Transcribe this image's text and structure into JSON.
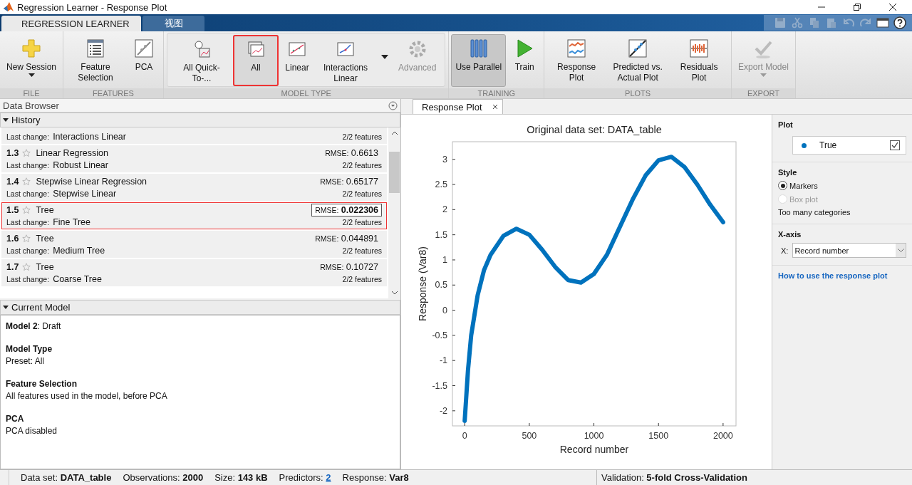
{
  "window": {
    "title": "Regression Learner - Response Plot"
  },
  "ribbon_tabs": [
    {
      "label": "REGRESSION LEARNER",
      "selected": true
    },
    {
      "label": "视图",
      "selected": false
    }
  ],
  "quick_access": [
    {
      "kind": "save",
      "disabled": true
    },
    {
      "kind": "cut",
      "disabled": true
    },
    {
      "kind": "copy",
      "disabled": true
    },
    {
      "kind": "paste",
      "disabled": true
    },
    {
      "kind": "undo",
      "disabled": true
    },
    {
      "kind": "redo",
      "disabled": true
    },
    {
      "kind": "window",
      "disabled": false
    },
    {
      "kind": "help",
      "disabled": false
    }
  ],
  "ribbon_groups": [
    {
      "label": "FILE",
      "buttons": [
        {
          "label": "New Session",
          "selected": false,
          "disabled": false,
          "caret": true
        }
      ]
    },
    {
      "label": "FEATURES",
      "buttons": [
        {
          "label": "Feature Selection",
          "selected": false,
          "disabled": false,
          "caret": false
        },
        {
          "label": "PCA",
          "selected": false,
          "disabled": false,
          "caret": false
        }
      ]
    },
    {
      "label": "MODEL TYPE",
      "buttons": [
        {
          "label": "All Quick-To-...",
          "selected": false,
          "disabled": false,
          "caret": false
        },
        {
          "label": "All",
          "selected": true,
          "disabled": false,
          "caret": false
        },
        {
          "label": "Linear",
          "selected": false,
          "disabled": false,
          "caret": false
        },
        {
          "label": "Interactions Linear",
          "selected": false,
          "disabled": false,
          "caret": false
        },
        {
          "label": "Advanced",
          "selected": false,
          "disabled": true,
          "caret": false
        }
      ]
    },
    {
      "label": "TRAINING",
      "buttons": [
        {
          "label": "Use Parallel",
          "selected": true,
          "disabled": false,
          "caret": false
        },
        {
          "label": "Train",
          "selected": false,
          "disabled": false,
          "caret": false
        }
      ]
    },
    {
      "label": "PLOTS",
      "buttons": [
        {
          "label": "Response Plot",
          "selected": false,
          "disabled": false,
          "caret": false
        },
        {
          "label": "Predicted vs. Actual Plot",
          "selected": false,
          "disabled": false,
          "caret": false
        },
        {
          "label": "Residuals Plot",
          "selected": false,
          "disabled": false,
          "caret": false
        }
      ]
    },
    {
      "label": "EXPORT",
      "buttons": [
        {
          "label": "Export Model",
          "selected": false,
          "disabled": true,
          "caret": true
        }
      ]
    }
  ],
  "data_browser": {
    "title": "Data Browser",
    "history": {
      "title": "History",
      "expanded": true,
      "models": [
        {
          "last_change_label": "Last change:",
          "last_change": "Interactions Linear",
          "features": "2/2 features",
          "selected": false
        },
        {
          "number": "1.3",
          "name": "Linear Regression",
          "rmse_label": "RMSE:",
          "rmse": "0.6613",
          "last_change_label": "Last change:",
          "last_change": "Robust Linear",
          "features": "2/2 features",
          "selected": false
        },
        {
          "number": "1.4",
          "name": "Stepwise Linear Regression",
          "rmse_label": "RMSE:",
          "rmse": "0.65177",
          "last_change_label": "Last change:",
          "last_change": "Stepwise Linear",
          "features": "2/2 features",
          "selected": false
        },
        {
          "number": "1.5",
          "name": "Tree",
          "rmse_label": "RMSE:",
          "rmse": "0.022306",
          "last_change_label": "Last change:",
          "last_change": "Fine Tree",
          "features": "2/2 features",
          "selected": true
        },
        {
          "number": "1.6",
          "name": "Tree",
          "rmse_label": "RMSE:",
          "rmse": "0.044891",
          "last_change_label": "Last change:",
          "last_change": "Medium Tree",
          "features": "2/2 features",
          "selected": false
        },
        {
          "number": "1.7",
          "name": "Tree",
          "rmse_label": "RMSE:",
          "rmse": "0.10727",
          "last_change_label": "Last change:",
          "last_change": "Coarse Tree",
          "features": "2/2 features",
          "selected": false
        }
      ]
    },
    "current_model": {
      "title": "Current Model",
      "expanded": true,
      "heading": "**Model 2**: Draft",
      "sections": [
        {
          "title": "Model Type",
          "text": "Preset: All"
        },
        {
          "title": "Feature Selection",
          "text": "All features used in the model, before PCA"
        },
        {
          "title": "PCA",
          "text": "PCA disabled"
        }
      ]
    }
  },
  "document_tabs": [
    {
      "label": "Response Plot",
      "selected": true
    }
  ],
  "plot": {
    "chart_data": {
      "type": "line",
      "title": "Original data set: DATA_table",
      "xlabel": "Record number",
      "ylabel": "Response (Var8)",
      "xlim": [
        -95,
        2100
      ],
      "ylim": [
        -2.3,
        3.35
      ],
      "xticks": [
        0,
        500,
        1000,
        1500,
        2000
      ],
      "yticks": [
        -2,
        -1.5,
        -1,
        -0.5,
        0,
        0.5,
        1,
        1.5,
        2,
        2.5,
        3
      ],
      "x": [
        0,
        25,
        50,
        100,
        150,
        200,
        300,
        400,
        500,
        600,
        700,
        800,
        900,
        1000,
        1100,
        1200,
        1300,
        1400,
        1500,
        1600,
        1700,
        1800,
        1900,
        2000
      ],
      "series": [
        {
          "name": "True",
          "color": "#0072bd",
          "values": [
            -2.2,
            -1.2,
            -0.5,
            0.3,
            0.8,
            1.1,
            1.48,
            1.62,
            1.5,
            1.2,
            0.86,
            0.6,
            0.55,
            0.72,
            1.1,
            1.65,
            2.2,
            2.68,
            2.98,
            3.05,
            2.85,
            2.5,
            2.1,
            1.75
          ]
        }
      ]
    }
  },
  "options": {
    "plot": {
      "title": "Plot",
      "legend": [
        {
          "checked": true
        }
      ]
    },
    "style": {
      "title": "Style",
      "options": [
        {
          "label": "Markers",
          "selected": true,
          "disabled": false
        },
        {
          "label": "Box plot",
          "selected": false,
          "disabled": true
        }
      ],
      "note": "Too many categories"
    },
    "x_axis": {
      "title": "X-axis",
      "label": "X:",
      "value": "Record number"
    },
    "help_link": "How to use the response plot"
  },
  "status_bar": {
    "left": [
      {
        "label": "Data set:",
        "value": "DATA_table",
        "kind": "text"
      },
      {
        "label": "Observations:",
        "value": "2000",
        "kind": "text"
      },
      {
        "label": "Size:",
        "value": "143 kB",
        "kind": "text"
      },
      {
        "label": "Predictors:",
        "value": "2",
        "kind": "link"
      },
      {
        "label": "Response:",
        "value": "Var8",
        "kind": "text"
      }
    ],
    "right": [
      {
        "label": "Validation:",
        "value": "5-fold Cross-Validation",
        "kind": "text"
      }
    ]
  }
}
